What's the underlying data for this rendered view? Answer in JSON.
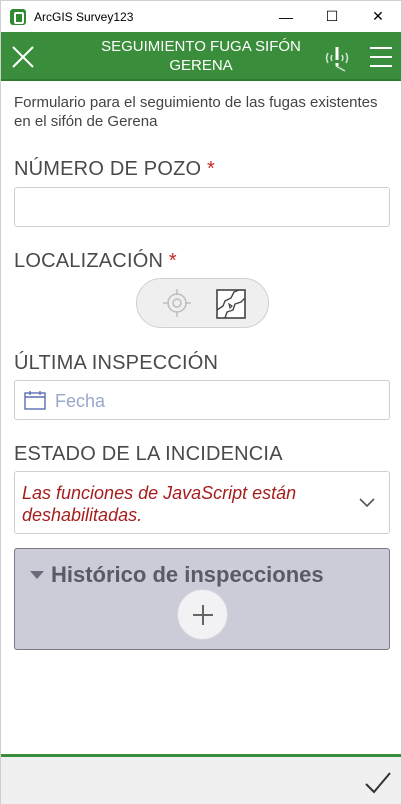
{
  "window": {
    "title": "ArcGIS Survey123",
    "minimize_glyph": "—",
    "maximize_glyph": "☐",
    "close_glyph": "✕"
  },
  "header": {
    "title": "SEGUIMIENTO FUGA SIFÓN GERENA",
    "close_icon": "close-icon",
    "gps_icon": "gps-warning-icon",
    "menu_icon": "hamburger-menu-icon",
    "color": "#3a8d3b"
  },
  "form": {
    "description": "Formulario para el seguimiento de las fugas existentes en el sifón de Gerena",
    "pozo": {
      "label": "NÚMERO DE POZO",
      "required": "*",
      "value": ""
    },
    "localizacion": {
      "label": "LOCALIZACIÓN",
      "required": "*"
    },
    "inspeccion": {
      "label": "ÚLTIMA INSPECCIÓN",
      "placeholder": "Fecha"
    },
    "estado": {
      "label": "ESTADO DE LA INCIDENCIA",
      "message": "Las funciones de JavaScript están deshabilitadas."
    },
    "historico": {
      "label": "Histórico de inspecciones"
    }
  },
  "colors": {
    "required": "#c62828",
    "error_text": "#a61d1d",
    "placeholder": "#9aa6cc"
  }
}
